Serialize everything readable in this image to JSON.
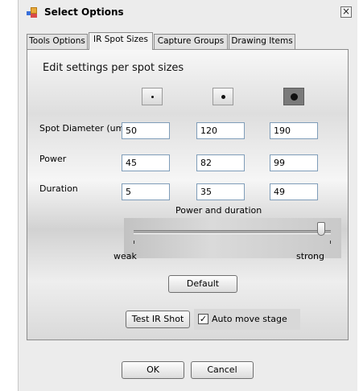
{
  "window": {
    "title": "Select Options",
    "close_symbol": "×",
    "icon": "app-icon"
  },
  "tabs": [
    {
      "label": "Tools Options",
      "active": false
    },
    {
      "label": "IR Spot Sizes",
      "active": true
    },
    {
      "label": "Capture Groups",
      "active": false
    },
    {
      "label": "Drawing Items",
      "active": false
    }
  ],
  "panel": {
    "heading": "Edit settings per spot sizes",
    "spot_buttons": [
      {
        "icon": "small-spot-icon",
        "selected": false
      },
      {
        "icon": "medium-spot-icon",
        "selected": false
      },
      {
        "icon": "large-spot-icon",
        "selected": true
      }
    ],
    "rows": [
      {
        "label": "Spot Diameter (um)",
        "values": [
          "50",
          "120",
          "190"
        ]
      },
      {
        "label": "Power",
        "values": [
          "45",
          "82",
          "99"
        ]
      },
      {
        "label": "Duration",
        "values": [
          "5",
          "35",
          "49"
        ]
      }
    ],
    "slider": {
      "label": "Power and duration",
      "min_label": "weak",
      "max_label": "strong",
      "value_fraction": 0.95
    },
    "default_button": "Default",
    "test_button": "Test IR Shot",
    "auto_move": {
      "label": "Auto move stage",
      "checked": true,
      "check_mark": "✓"
    }
  },
  "footer": {
    "ok_label": "OK",
    "cancel_label": "Cancel"
  }
}
